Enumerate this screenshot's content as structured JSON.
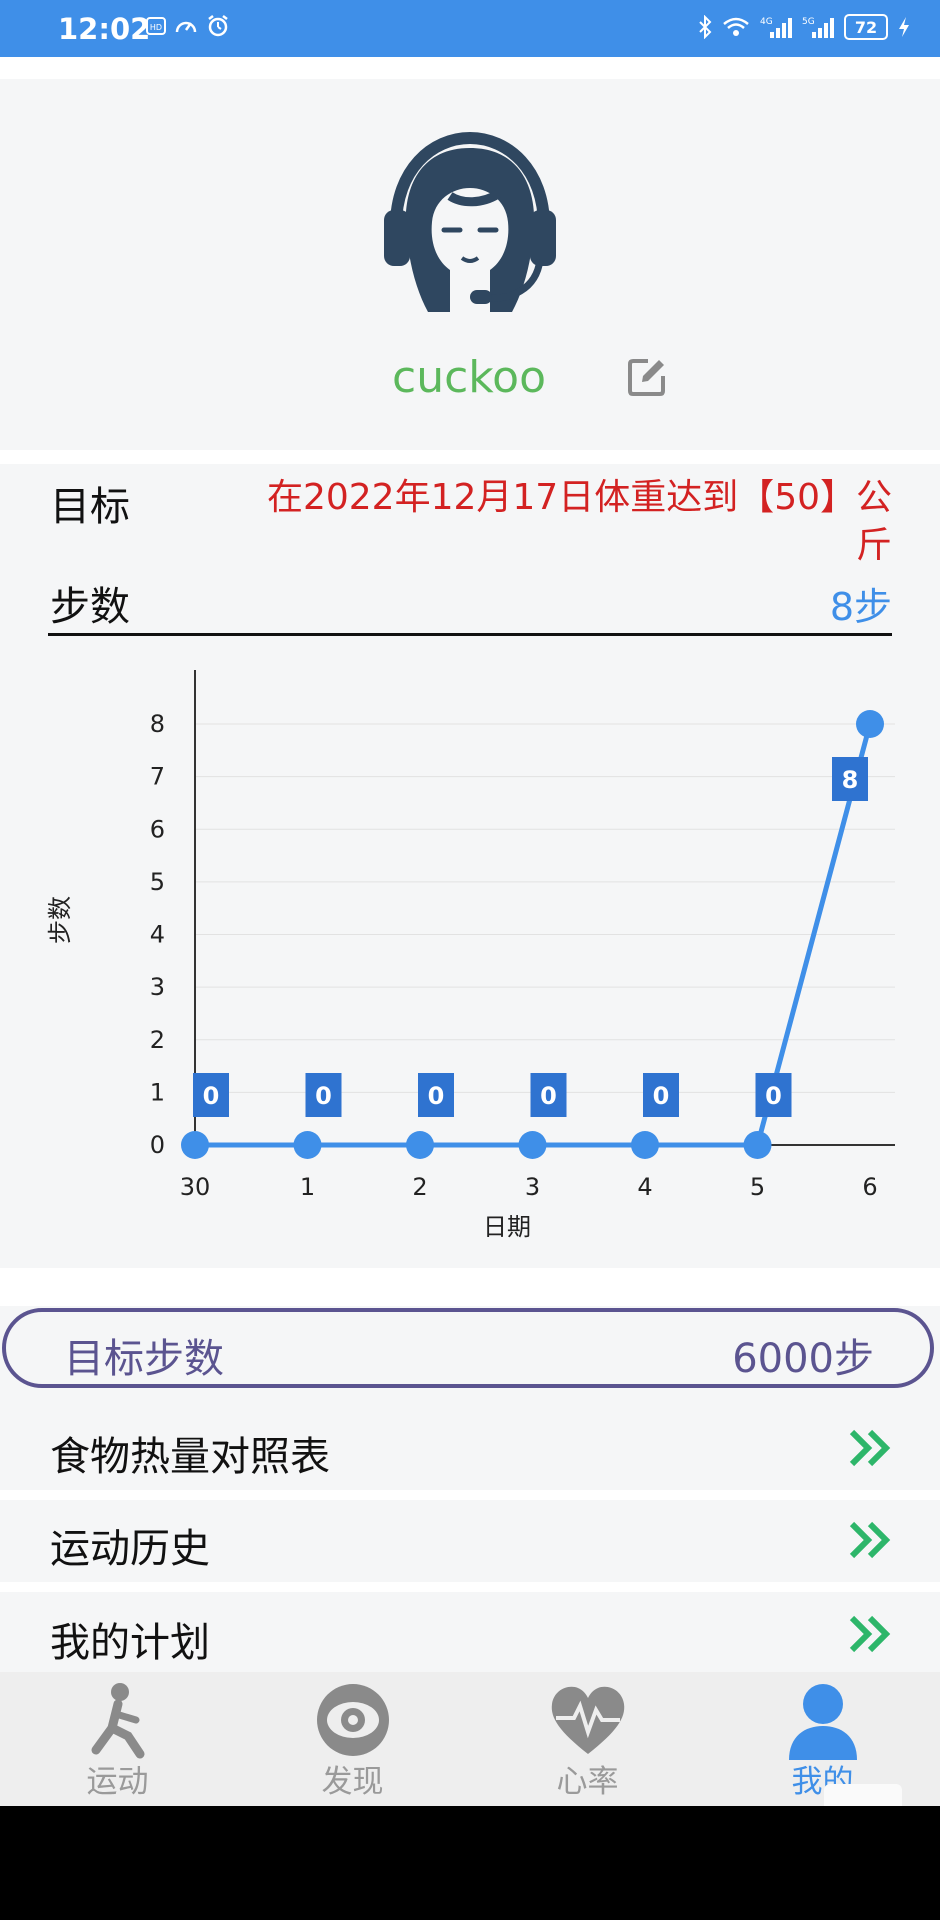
{
  "status_bar": {
    "time": "12:02",
    "battery": "72",
    "signal_left": "4G",
    "signal_right": "5G"
  },
  "profile": {
    "username": "cuckoo"
  },
  "goal": {
    "label": "目标",
    "text": "在2022年12月17日体重达到【50】公斤"
  },
  "steps": {
    "label": "步数",
    "value": "8步"
  },
  "chart_data": {
    "type": "line",
    "categories": [
      "30",
      "1",
      "2",
      "3",
      "4",
      "5",
      "6"
    ],
    "values": [
      0,
      0,
      0,
      0,
      0,
      0,
      8
    ],
    "data_labels": [
      "0",
      "0",
      "0",
      "0",
      "0",
      "0",
      "8"
    ],
    "ylabel": "步数",
    "xlabel": "日期",
    "ylim": [
      0,
      8
    ],
    "yticks": [
      "0",
      "1",
      "2",
      "3",
      "4",
      "5",
      "6",
      "7",
      "8"
    ],
    "grid": true,
    "color": "#3f8fe8",
    "label_bg": "#2f73d0"
  },
  "target_steps": {
    "label": "目标步数",
    "value": "6000步"
  },
  "menu": [
    {
      "label": "食物热量对照表"
    },
    {
      "label": "运动历史"
    },
    {
      "label": "我的计划"
    }
  ],
  "nav": [
    {
      "label": "运动",
      "icon": "running-icon"
    },
    {
      "label": "发现",
      "icon": "eye-icon"
    },
    {
      "label": "心率",
      "icon": "heart-rate-icon"
    },
    {
      "label": "我的",
      "icon": "user-icon",
      "active": true
    }
  ],
  "colors": {
    "accent": "#3f8fe8",
    "goal_red": "#d32222",
    "username_green": "#5cb85c",
    "pill_purple": "#5b5490",
    "chevron_green": "#2db66a"
  }
}
